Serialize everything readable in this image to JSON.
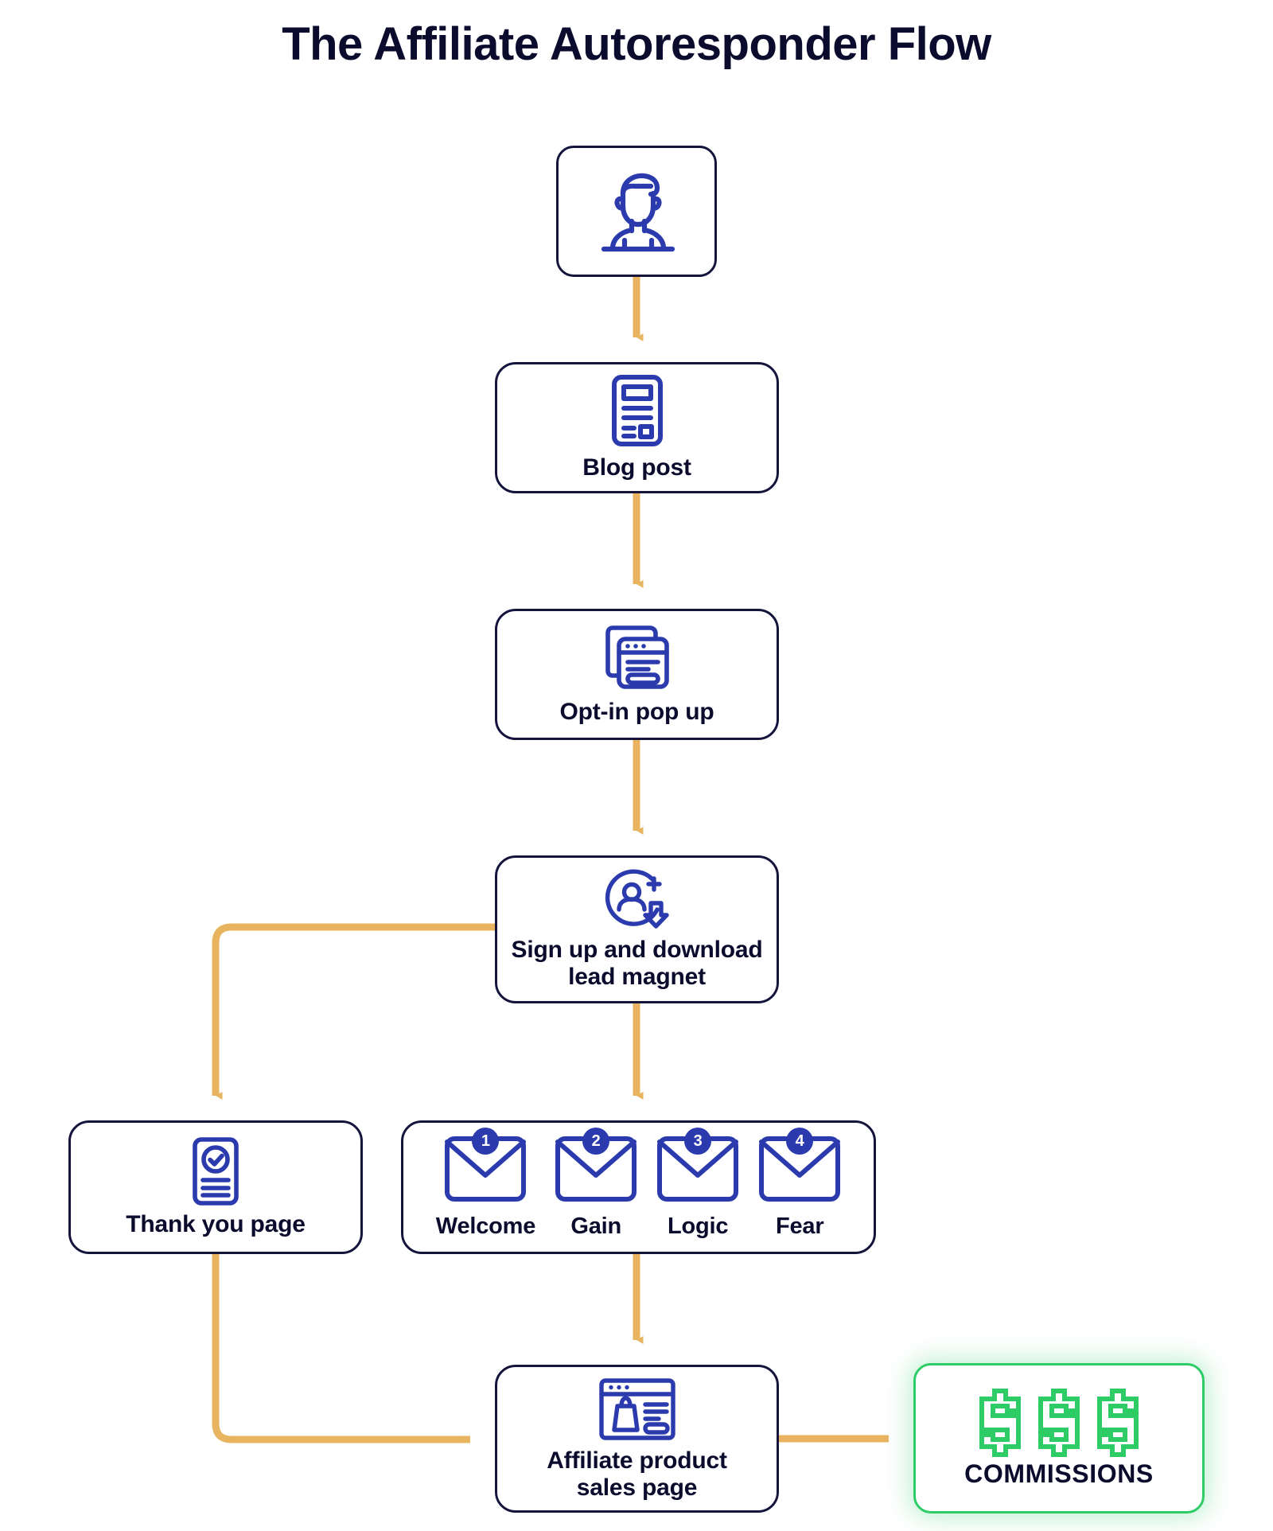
{
  "title": "The Affiliate Autoresponder Flow",
  "theme": {
    "background": "#ffffff",
    "text_dark": "#0b0b2d",
    "node_border": "#14143c",
    "icon_blue": "#2b3bad",
    "arrow_gold": "#e8b45f",
    "accent_green": "#2ecc67"
  },
  "nodes": {
    "visitor": {
      "label": "",
      "icon": "person-avatar-icon"
    },
    "blog": {
      "label": "Blog post",
      "icon": "document-article-icon"
    },
    "optin": {
      "label": "Opt-in pop up",
      "icon": "browser-popup-icon"
    },
    "signup": {
      "label": "Sign up and download\nlead magnet",
      "line1": "Sign up and download",
      "line2": "lead magnet",
      "icon": "user-plus-download-icon"
    },
    "thankyou": {
      "label": "Thank you page",
      "icon": "document-check-icon"
    },
    "sales": {
      "label": "Affiliate product\nsales page",
      "line1": "Affiliate product",
      "line2": "sales page",
      "icon": "browser-shopping-bag-icon"
    },
    "commissions": {
      "label": "COMMISSIONS",
      "icon": "dollar-signs-icon",
      "symbols": [
        "$",
        "$",
        "$"
      ]
    }
  },
  "email_sequence": [
    {
      "number": "1",
      "label": "Welcome",
      "icon": "envelope-icon"
    },
    {
      "number": "2",
      "label": "Gain",
      "icon": "envelope-icon"
    },
    {
      "number": "3",
      "label": "Logic",
      "icon": "envelope-icon"
    },
    {
      "number": "4",
      "label": "Fear",
      "icon": "envelope-icon"
    }
  ],
  "chart_data": {
    "type": "diagram",
    "title": "The Affiliate Autoresponder Flow",
    "diagram_kind": "flowchart",
    "nodes": [
      {
        "id": "visitor",
        "label": "",
        "icon": "person-avatar-icon"
      },
      {
        "id": "blog",
        "label": "Blog post"
      },
      {
        "id": "optin",
        "label": "Opt-in pop up"
      },
      {
        "id": "signup",
        "label": "Sign up and download lead magnet"
      },
      {
        "id": "thankyou",
        "label": "Thank you page"
      },
      {
        "id": "emails",
        "label": "Welcome / Gain / Logic / Fear"
      },
      {
        "id": "sales",
        "label": "Affiliate product sales page"
      },
      {
        "id": "commissions",
        "label": "COMMISSIONS"
      }
    ],
    "edges": [
      {
        "from": "visitor",
        "to": "blog"
      },
      {
        "from": "blog",
        "to": "optin"
      },
      {
        "from": "optin",
        "to": "signup"
      },
      {
        "from": "signup",
        "to": "thankyou"
      },
      {
        "from": "signup",
        "to": "emails"
      },
      {
        "from": "thankyou",
        "to": "sales"
      },
      {
        "from": "emails",
        "to": "sales"
      },
      {
        "from": "sales",
        "to": "commissions"
      }
    ]
  }
}
